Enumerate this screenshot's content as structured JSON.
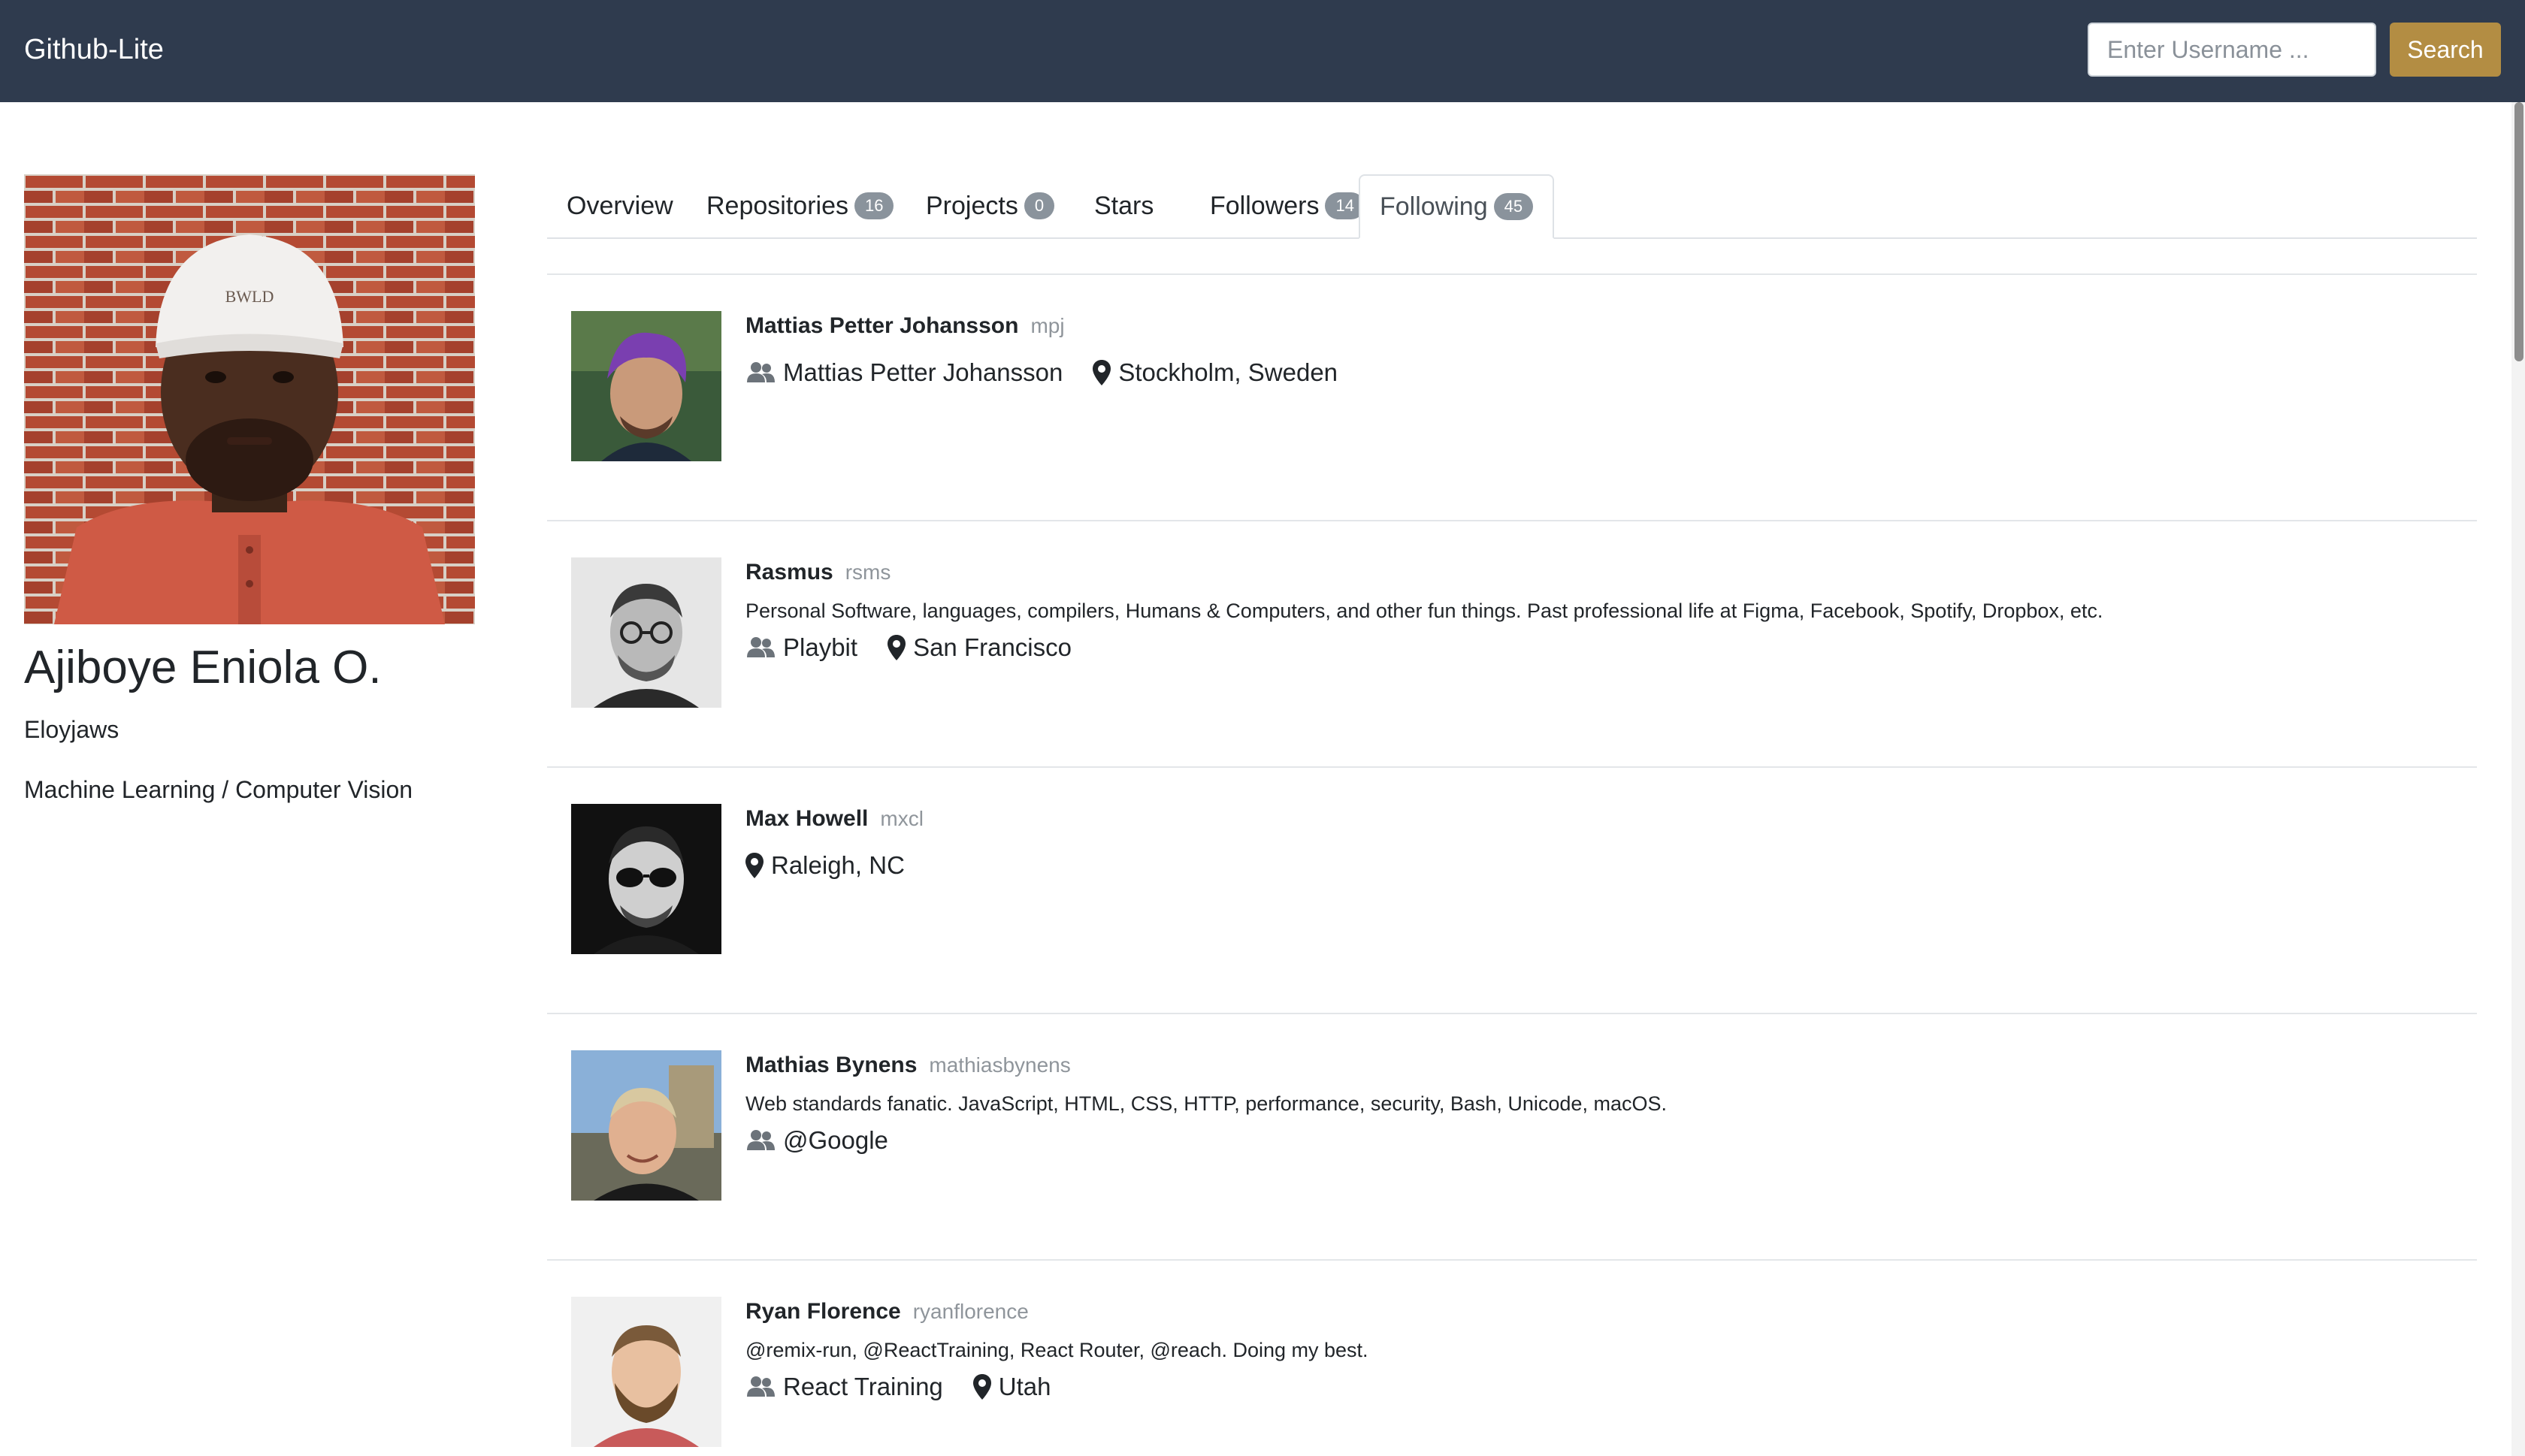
{
  "navbar": {
    "brand": "Github-Lite",
    "search_placeholder": "Enter Username ...",
    "search_button": "Search"
  },
  "profile": {
    "name": "Ajiboye Eniola O.",
    "login": "Eloyjaws",
    "bio": "Machine Learning / Computer Vision"
  },
  "tabs": [
    {
      "label": "Overview",
      "count": null,
      "active": false
    },
    {
      "label": "Repositories",
      "count": "16",
      "active": false
    },
    {
      "label": "Projects",
      "count": "0",
      "active": false
    },
    {
      "label": "Stars",
      "count": null,
      "active": false
    },
    {
      "label": "Followers",
      "count": "14",
      "active": false
    },
    {
      "label": "Following",
      "count": "45",
      "active": true
    }
  ],
  "following": [
    {
      "name": "Mattias Petter Johansson",
      "login": "mpj",
      "bio": "",
      "company": "Mattias Petter Johansson",
      "location": "Stockholm, Sweden"
    },
    {
      "name": "Rasmus",
      "login": "rsms",
      "bio": "Personal Software, languages, compilers, Humans & Computers, and other fun things. Past professional life at Figma, Facebook, Spotify, Dropbox, etc.",
      "company": "Playbit",
      "location": "San Francisco"
    },
    {
      "name": "Max Howell",
      "login": "mxcl",
      "bio": "",
      "company": "",
      "location": "Raleigh, NC"
    },
    {
      "name": "Mathias Bynens",
      "login": "mathiasbynens",
      "bio": "Web standards fanatic. JavaScript, HTML, CSS, HTTP, performance, security, Bash, Unicode, macOS.",
      "company": "@Google",
      "location": ""
    },
    {
      "name": "Ryan Florence",
      "login": "ryanflorence",
      "bio": "@remix-run, @ReactTraining, React Router, @reach. Doing my best.",
      "company": "React Training",
      "location": "Utah"
    }
  ],
  "icons": {
    "company": "users-icon",
    "location": "map-marker-icon"
  },
  "colors": {
    "navbar_bg": "#2f3b4e",
    "search_button_bg": "#b38d43",
    "badge_bg": "#8a939c"
  }
}
